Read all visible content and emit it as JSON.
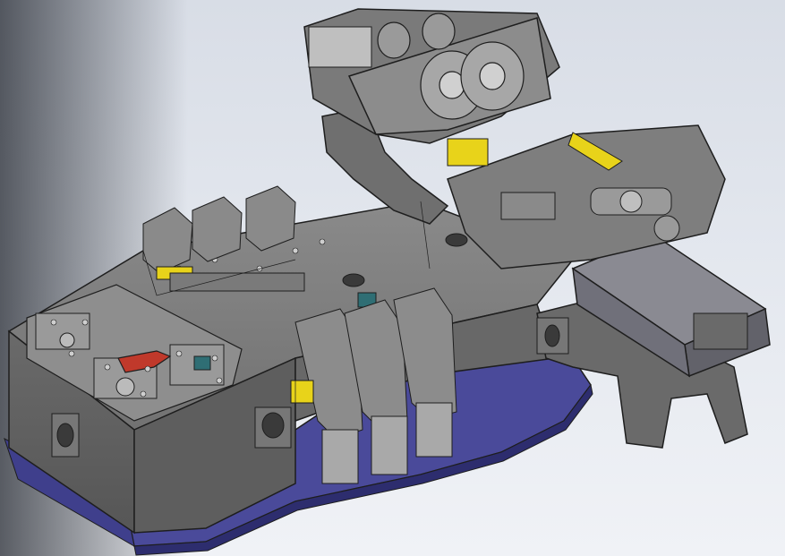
{
  "viewport": {
    "background_top": "#d8dde6",
    "background_bottom": "#f0f2f6"
  },
  "model": {
    "body_color": "#6e6e6e",
    "edge_color": "#1e1e1e",
    "base_plate_color": "#4a4a9a",
    "accent_yellow": "#e8d31a",
    "accent_red": "#c0392b",
    "accent_teal": "#2f6e74"
  }
}
